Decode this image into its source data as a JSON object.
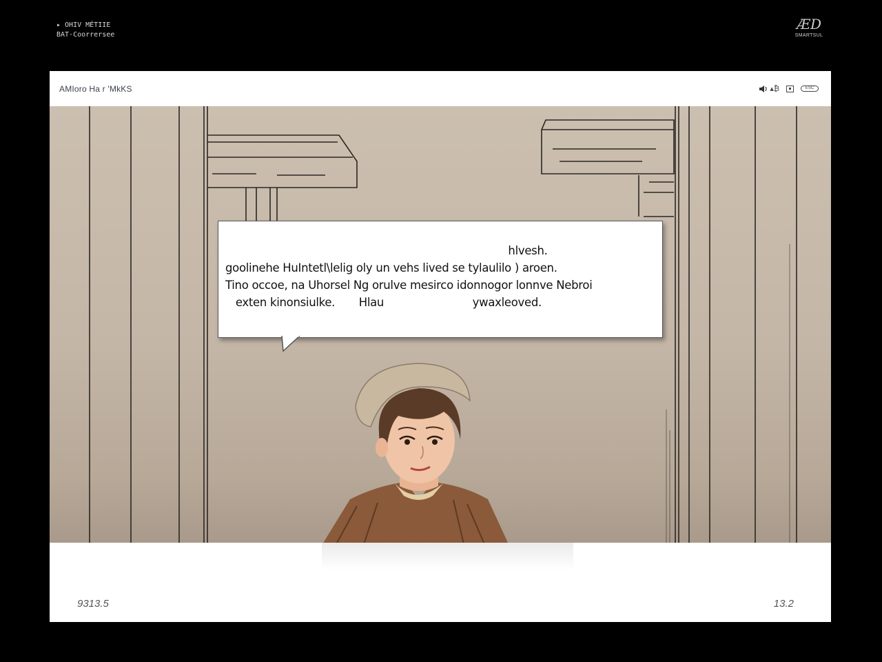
{
  "corner": {
    "top_left_line1": "▸ OHIV  MÉTIIE",
    "top_left_line2": "BAT·Coorrersee",
    "top_right_logo": "ÆD",
    "top_right_sub": "SMARTSUL"
  },
  "window": {
    "title": "AMIoro Ha r 'MkKS",
    "controls": {
      "volume_label": "▴₿",
      "box_label": "",
      "pill_label": "ESC"
    }
  },
  "dialogue": {
    "text": "                                                                                   hlvesh.\ngoolinehe HuIntetl\\lelig oly un vehs lived se tylaulilo ) aroen.\nTino occoe, na Uhorsel Ng orulve mesirco idonnogor lonnve Nebroi\n   exten kinonsiulke.       Hlau                          ywaxleoved."
  },
  "status": {
    "left": "9313.5",
    "right": "13.2"
  },
  "colors": {
    "background": "#000000",
    "scene_wall": "#c7baa9",
    "line_art": "#2a2622"
  }
}
